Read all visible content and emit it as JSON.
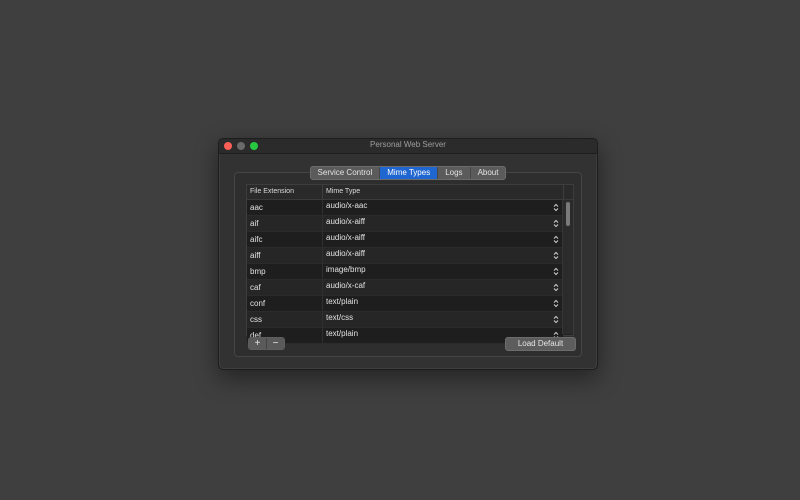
{
  "window": {
    "title": "Personal Web Server"
  },
  "tabs": [
    {
      "label": "Service Control",
      "active": false
    },
    {
      "label": "Mime Types",
      "active": true
    },
    {
      "label": "Logs",
      "active": false
    },
    {
      "label": "About",
      "active": false
    }
  ],
  "table": {
    "headers": {
      "extension": "File Extension",
      "mime": "Mime Type"
    },
    "rows": [
      {
        "ext": "aac",
        "mime": "audio/x-aac"
      },
      {
        "ext": "aif",
        "mime": "audio/x-aiff"
      },
      {
        "ext": "aifc",
        "mime": "audio/x-aiff"
      },
      {
        "ext": "aiff",
        "mime": "audio/x-aiff"
      },
      {
        "ext": "bmp",
        "mime": "image/bmp"
      },
      {
        "ext": "caf",
        "mime": "audio/x-caf"
      },
      {
        "ext": "conf",
        "mime": "text/plain"
      },
      {
        "ext": "css",
        "mime": "text/css"
      },
      {
        "ext": "def",
        "mime": "text/plain"
      }
    ]
  },
  "buttons": {
    "add": "+",
    "remove": "−",
    "load_default": "Load Default"
  },
  "colors": {
    "accent": "#1f66d0",
    "close": "#fe5f57",
    "zoom": "#28c840"
  },
  "icons": {
    "stepper": "up-down-chevron-icon"
  }
}
